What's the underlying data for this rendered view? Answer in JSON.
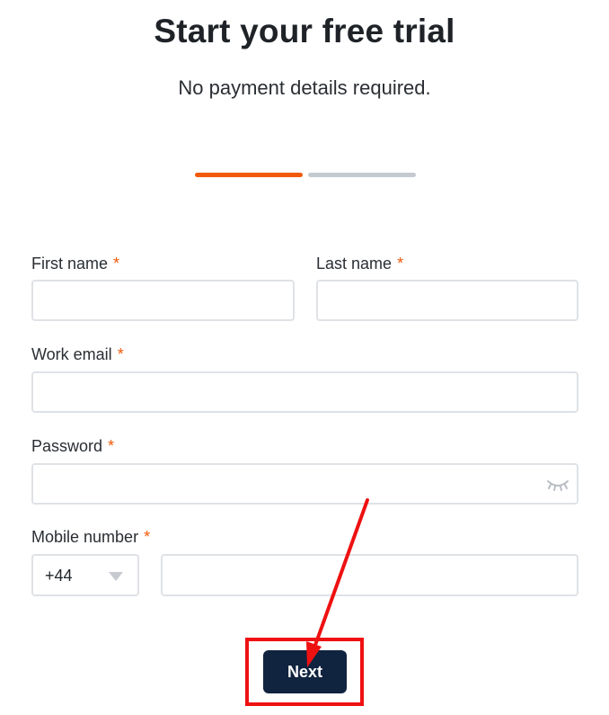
{
  "page": {
    "title": "Start your free trial",
    "subtitle": "No payment details required."
  },
  "progress": {
    "current_step": 1,
    "total_steps": 2,
    "active_color": "#f25a0a",
    "inactive_color": "#c5cad1"
  },
  "form": {
    "required_marker": "*",
    "required_color": "#f25a0a",
    "first_name": {
      "label": "First name",
      "value": ""
    },
    "last_name": {
      "label": "Last name",
      "value": ""
    },
    "work_email": {
      "label": "Work email",
      "value": ""
    },
    "password": {
      "label": "Password",
      "value": "",
      "toggle_icon": "eye-closed-icon"
    },
    "mobile": {
      "label": "Mobile number",
      "country_code": "+44",
      "value": ""
    }
  },
  "actions": {
    "next_label": "Next",
    "next_color": "#10233f"
  },
  "annotation": {
    "color": "#ee1111"
  }
}
